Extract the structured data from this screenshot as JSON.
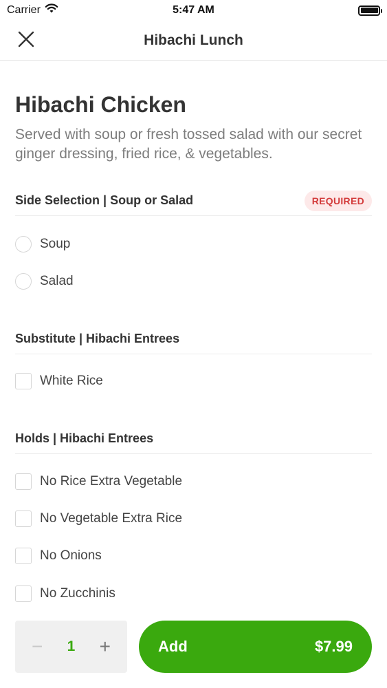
{
  "status_bar": {
    "carrier": "Carrier",
    "time": "5:47 AM",
    "icons": [
      "wifi-icon",
      "battery-icon"
    ]
  },
  "nav": {
    "title": "Hibachi Lunch",
    "close_icon": "close-icon"
  },
  "item": {
    "title": "Hibachi Chicken",
    "description": "Served with soup or fresh tossed salad with our secret ginger dressing, fried rice, & vegetables."
  },
  "sections": [
    {
      "title": "Side Selection | Soup or Salad",
      "badge": "REQUIRED",
      "type": "radio",
      "options": [
        "Soup",
        "Salad"
      ]
    },
    {
      "title": "Substitute | Hibachi Entrees",
      "type": "checkbox",
      "options": [
        "White Rice"
      ]
    },
    {
      "title": "Holds | Hibachi Entrees",
      "type": "checkbox",
      "options": [
        "No Rice Extra Vegetable",
        "No Vegetable Extra Rice",
        "No Onions",
        "No Zucchinis"
      ]
    }
  ],
  "quantity": {
    "minus": "−",
    "value": "1",
    "plus": "+"
  },
  "add_button": {
    "label": "Add",
    "price": "$7.99"
  },
  "colors": {
    "accent": "#3aa90e",
    "required_bg": "#fde9e9",
    "required_text": "#d33b3b"
  }
}
